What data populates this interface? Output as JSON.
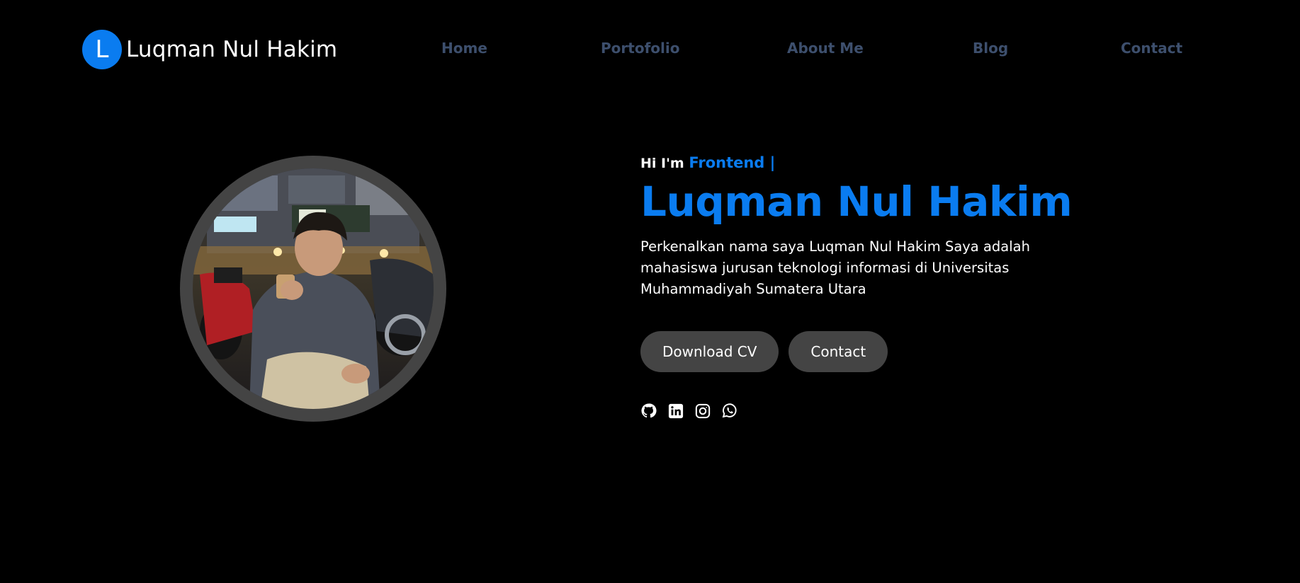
{
  "brand": {
    "logo_letter": "L",
    "name": "Luqman Nul Hakim"
  },
  "nav": {
    "items": [
      {
        "label": "Home"
      },
      {
        "label": "Portofolio"
      },
      {
        "label": "About Me"
      },
      {
        "label": "Blog"
      },
      {
        "label": "Contact"
      }
    ]
  },
  "hero": {
    "greeting": "Hi I'm",
    "role": "Frontend |",
    "name": "Luqman Nul Hakim",
    "description": "Perkenalkan nama saya Luqman Nul Hakim Saya adalah mahasiswa jurusan teknologi informasi di Universitas Muhammadiyah Sumatera Utara",
    "buttons": {
      "download_cv": "Download CV",
      "contact": "Contact"
    },
    "photo_icon": "profile-photo"
  },
  "socials": [
    {
      "icon": "github-icon"
    },
    {
      "icon": "linkedin-icon"
    },
    {
      "icon": "instagram-icon"
    },
    {
      "icon": "whatsapp-icon"
    }
  ],
  "colors": {
    "accent": "#0a7cf0",
    "background": "#000000",
    "nav_link": "#3d4f6d",
    "button_bg": "#444444"
  }
}
